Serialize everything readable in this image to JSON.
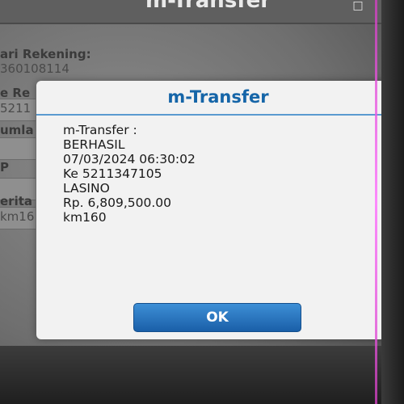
{
  "app": {
    "title": "m-Transfer"
  },
  "background_form": {
    "source_account_label": "ari Rekening:",
    "source_account_value": "360108114",
    "field2_label": "e Re",
    "field2_value": "5211",
    "field3_label": "umla",
    "field4_label": "P",
    "field5_label": "erita",
    "field5_value": "km16"
  },
  "dialog": {
    "title": "m-Transfer",
    "message_lines": [
      "m-Transfer :",
      "BERHASIL",
      "07/03/2024 06:30:02",
      "Ke 5211347105",
      "LASINO",
      "Rp. 6,809,500.00",
      "km160"
    ],
    "ok_label": "OK"
  },
  "colors": {
    "dialog_title": "#1565a8",
    "ok_button": "#2a78c4",
    "dialog_background": "#f2f2f2"
  }
}
